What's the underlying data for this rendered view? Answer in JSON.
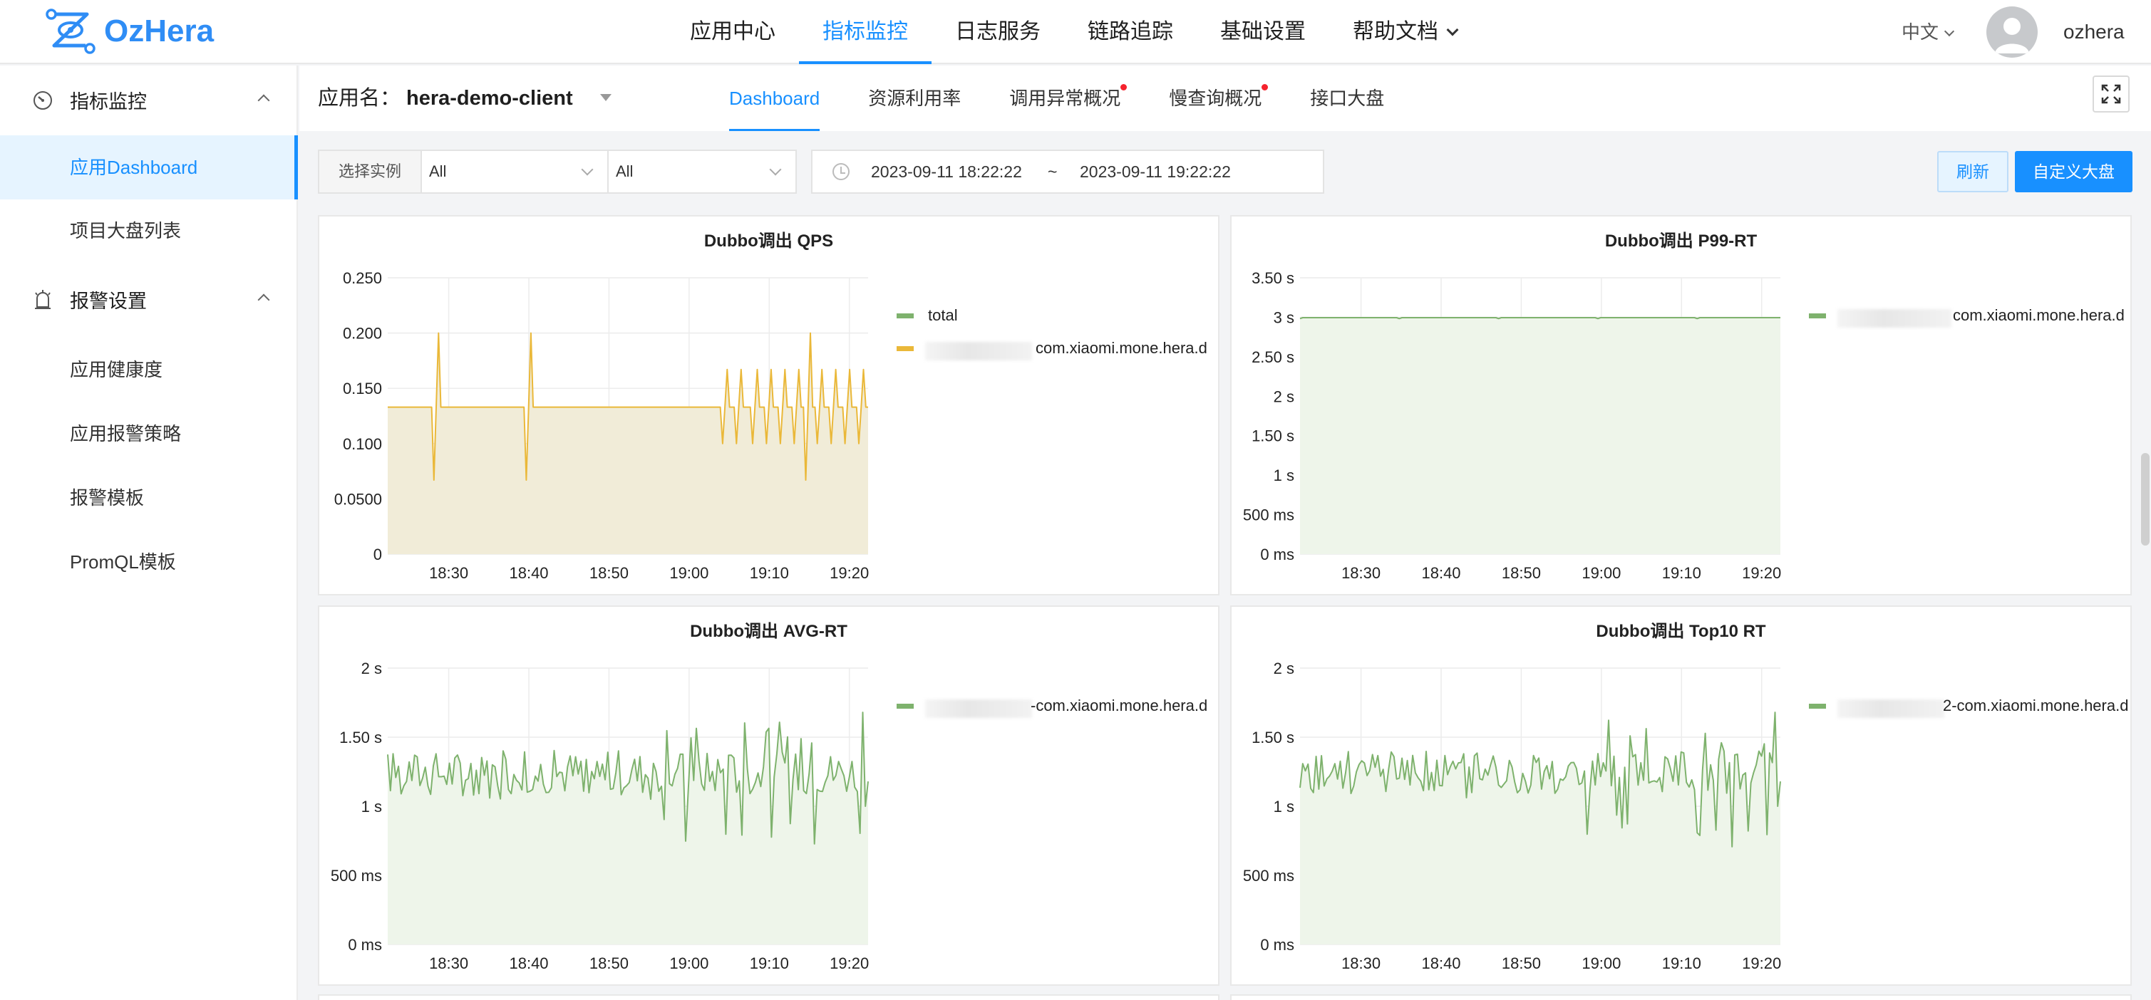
{
  "brand": {
    "name": "OzHera",
    "color": "#2f8df5"
  },
  "nav": {
    "items": [
      {
        "label": "应用中心"
      },
      {
        "label": "指标监控",
        "active": true
      },
      {
        "label": "日志服务"
      },
      {
        "label": "链路追踪"
      },
      {
        "label": "基础设置"
      },
      {
        "label": "帮助文档",
        "dropdown": true
      }
    ],
    "language": "中文",
    "username": "ozhera"
  },
  "sidebar": {
    "groups": [
      {
        "label": "指标监控",
        "icon": "gauge-icon",
        "items": [
          "应用Dashboard",
          "项目大盘列表"
        ]
      },
      {
        "label": "报警设置",
        "icon": "alarm-icon",
        "items": [
          "应用健康度",
          "应用报警策略",
          "报警模板",
          "PromQL模板"
        ]
      }
    ],
    "active_item": "应用Dashboard"
  },
  "header": {
    "app_label": "应用名：",
    "app_name": "hera-demo-client",
    "tabs": [
      {
        "label": "Dashboard",
        "active": true
      },
      {
        "label": "资源利用率"
      },
      {
        "label": "调用异常概况",
        "badge": true
      },
      {
        "label": "慢查询概况",
        "badge": true
      },
      {
        "label": "接口大盘"
      }
    ]
  },
  "filters": {
    "instance_label": "选择实例",
    "select_1": "All",
    "select_2": "All",
    "time_start": "2023-09-11 18:22:22",
    "time_sep": "~",
    "time_end": "2023-09-11 19:22:22",
    "refresh_label": "刷新",
    "custom_label": "自定义大盘"
  },
  "colors": {
    "accent": "#1890ff",
    "qps_line": "#eab839",
    "qps_fill": "#f1ecd8",
    "green_line": "#7eb26d",
    "green_fill": "#eef5ea"
  },
  "chart_data": [
    {
      "type": "area",
      "title": "Dubbo调出 QPS",
      "x_ticks": [
        "18:30",
        "18:40",
        "18:50",
        "19:00",
        "19:10",
        "19:20"
      ],
      "y_ticks": [
        "0",
        "0.0500",
        "0.100",
        "0.150",
        "0.200",
        "0.250"
      ],
      "ylim": [
        0,
        0.25
      ],
      "series": [
        {
          "name": "total",
          "color": "#7eb26d",
          "values": []
        },
        {
          "name": "com.xiaomi.mone.hera.d",
          "color": "#eab839",
          "baseline": 0.133,
          "values": [
            0.133,
            0.133,
            0.133,
            0.133,
            0.133,
            0.133,
            0.133,
            0.133,
            0.133,
            0.133,
            0.133,
            0.133,
            0.133,
            0.133,
            0.133,
            0.133,
            0.133,
            0.133,
            0.133,
            0.133,
            0.067,
            0.133,
            0.2,
            0.133,
            0.133,
            0.133,
            0.133,
            0.133,
            0.133,
            0.133,
            0.133,
            0.133,
            0.133,
            0.133,
            0.133,
            0.133,
            0.133,
            0.133,
            0.133,
            0.133,
            0.133,
            0.133,
            0.133,
            0.133,
            0.133,
            0.133,
            0.133,
            0.133,
            0.133,
            0.133,
            0.133,
            0.133,
            0.133,
            0.133,
            0.133,
            0.133,
            0.133,
            0.133,
            0.133,
            0.133,
            0.067,
            0.133,
            0.2,
            0.133,
            0.133,
            0.133,
            0.133,
            0.133,
            0.133,
            0.133,
            0.133,
            0.133,
            0.133,
            0.133,
            0.133,
            0.133,
            0.133,
            0.133,
            0.133,
            0.133,
            0.133,
            0.133,
            0.133,
            0.133,
            0.133,
            0.133,
            0.133,
            0.133,
            0.133,
            0.133,
            0.133,
            0.133,
            0.133,
            0.133,
            0.133,
            0.133,
            0.133,
            0.133,
            0.133,
            0.133,
            0.133,
            0.133,
            0.133,
            0.133,
            0.133,
            0.133,
            0.133,
            0.133,
            0.133,
            0.133,
            0.133,
            0.133,
            0.133,
            0.133,
            0.133,
            0.133,
            0.133,
            0.133,
            0.133,
            0.133,
            0.133,
            0.133,
            0.133,
            0.133,
            0.133,
            0.133,
            0.133,
            0.133,
            0.133,
            0.133,
            0.133,
            0.133,
            0.133,
            0.133,
            0.133,
            0.133,
            0.133,
            0.133,
            0.133,
            0.133,
            0.133,
            0.133,
            0.133,
            0.133,
            0.133,
            0.1,
            0.133,
            0.167,
            0.133,
            0.133,
            0.133,
            0.1,
            0.133,
            0.167,
            0.133,
            0.133,
            0.133,
            0.133,
            0.1,
            0.133,
            0.167,
            0.133,
            0.133,
            0.133,
            0.1,
            0.133,
            0.167,
            0.133,
            0.133,
            0.133,
            0.1,
            0.133,
            0.167,
            0.133,
            0.133,
            0.133,
            0.1,
            0.133,
            0.167,
            0.133,
            0.133,
            0.067,
            0.133,
            0.2,
            0.133,
            0.133,
            0.1,
            0.133,
            0.167,
            0.133,
            0.133,
            0.133,
            0.1,
            0.133,
            0.167,
            0.133,
            0.133,
            0.133,
            0.1,
            0.133,
            0.167,
            0.133,
            0.133,
            0.133,
            0.1,
            0.133,
            0.167,
            0.133,
            0.133
          ]
        }
      ]
    },
    {
      "type": "area",
      "title": "Dubbo调出 P99-RT",
      "x_ticks": [
        "18:30",
        "18:40",
        "18:50",
        "19:00",
        "19:10",
        "19:20"
      ],
      "y_ticks": [
        "0 ms",
        "500 ms",
        "1 s",
        "1.50 s",
        "2 s",
        "2.50 s",
        "3 s",
        "3.50 s"
      ],
      "ylim": [
        0,
        3.5
      ],
      "series": [
        {
          "name": "com.xiaomi.mone.hera.d",
          "color": "#7eb26d",
          "flat": 2.995
        }
      ]
    },
    {
      "type": "area",
      "title": "Dubbo调出 AVG-RT",
      "x_ticks": [
        "18:30",
        "18:40",
        "18:50",
        "19:00",
        "19:10",
        "19:20"
      ],
      "y_ticks": [
        "0 ms",
        "500 ms",
        "1 s",
        "1.50 s",
        "2 s"
      ],
      "ylim": [
        0,
        2
      ],
      "series": [
        {
          "name": "-com.xiaomi.mone.hera.d",
          "color": "#7eb26d"
        }
      ]
    },
    {
      "type": "area",
      "title": "Dubbo调出 Top10 RT",
      "x_ticks": [
        "18:30",
        "18:40",
        "18:50",
        "19:00",
        "19:10",
        "19:20"
      ],
      "y_ticks": [
        "0 ms",
        "500 ms",
        "1 s",
        "1.50 s",
        "2 s"
      ],
      "ylim": [
        0,
        2
      ],
      "series": [
        {
          "name": "2-com.xiaomi.mone.hera.d",
          "color": "#7eb26d"
        }
      ]
    }
  ]
}
